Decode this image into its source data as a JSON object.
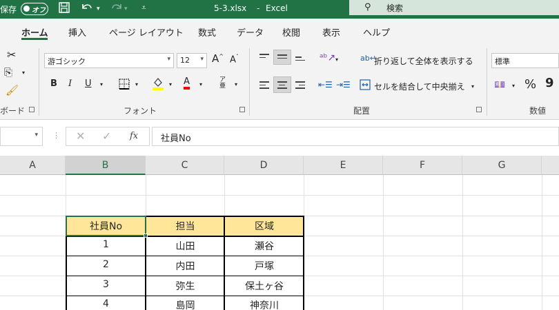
{
  "titlebar": {
    "autosave_label": "保存",
    "autosave_state": "オフ",
    "filename": "5-3.xlsx",
    "separator": "-",
    "app_name": "Excel",
    "search_placeholder": "検索",
    "accent_color": "#217346"
  },
  "tabs": [
    {
      "label": "ホーム",
      "active": true
    },
    {
      "label": "挿入"
    },
    {
      "label": "ページ レイアウト"
    },
    {
      "label": "数式"
    },
    {
      "label": "データ"
    },
    {
      "label": "校閲"
    },
    {
      "label": "表示"
    },
    {
      "label": "ヘルプ"
    }
  ],
  "ribbon": {
    "clipboard_label": "ボード",
    "font_group_label": "フォント",
    "font_name": "游ゴシック",
    "font_size": "12",
    "bold": "B",
    "italic": "I",
    "underline": "U",
    "grow_font": "A",
    "shrink_font": "A",
    "font_color_letter": "A",
    "highlight_color": "#ffff00",
    "font_color": "#ff0000",
    "alignment_group_label": "配置",
    "wrap_text": "折り返して全体を表示する",
    "merge_center": "セルを結合して中央揃え",
    "number_group_label": "数値",
    "number_format": "標準",
    "percent": "%"
  },
  "formula_bar": {
    "fx": "fx",
    "formula": "社員No"
  },
  "columns": [
    "A",
    "B",
    "C",
    "D",
    "E",
    "F",
    "G"
  ],
  "table": {
    "headers": [
      "社員No",
      "担当",
      "区域"
    ],
    "rows": [
      [
        "1",
        "山田",
        "瀬谷"
      ],
      [
        "2",
        "内田",
        "戸塚"
      ],
      [
        "3",
        "弥生",
        "保土ヶ谷"
      ],
      [
        "4",
        "島岡",
        "神奈川"
      ]
    ],
    "header_fill": "#ffe699"
  }
}
